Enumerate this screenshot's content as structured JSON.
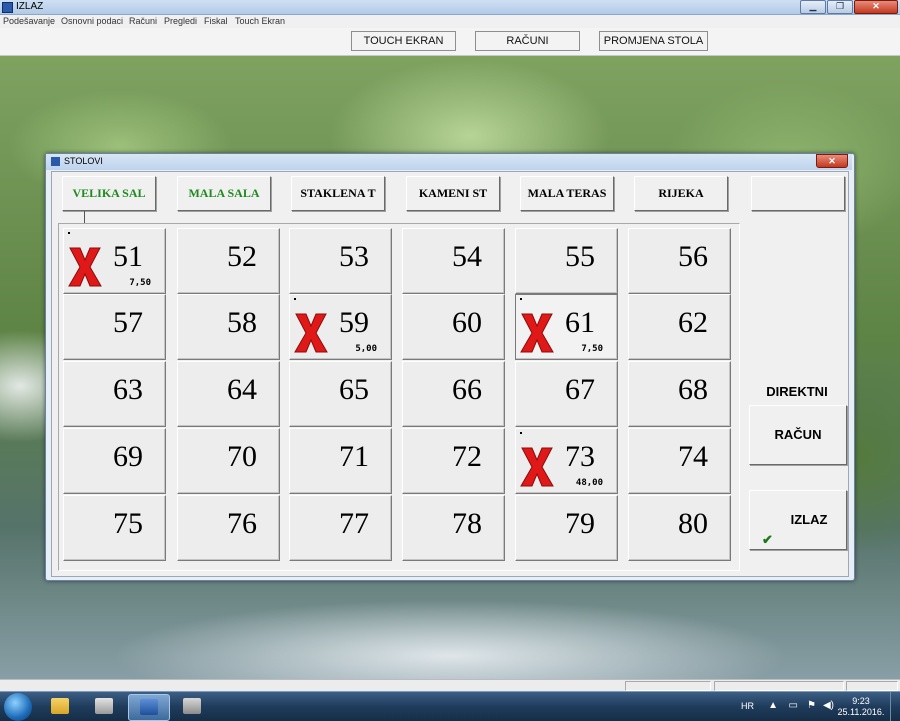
{
  "app": {
    "title": "IZLAZ",
    "window_controls": {
      "minimize": "▁",
      "maximize": "❐",
      "close": "✕"
    }
  },
  "menu": [
    "Podešavanje",
    "Osnovni podaci",
    "Računi",
    "Pregledi",
    "Fiskal",
    "Touch Ekran"
  ],
  "toolbar": {
    "touch_label": "TOUCH  EKRAN",
    "racuni_label": "RAČUNI",
    "promjena_label": "PROMJENA STOLA"
  },
  "dialog": {
    "title": "STOLOVI",
    "close": "✕",
    "rooms": [
      {
        "label": "VELIKA SAL",
        "color": "#1f8a1f"
      },
      {
        "label": "MALA SALA",
        "color": "#1f8a1f"
      },
      {
        "label": "STAKLENA T",
        "color": "#000000"
      },
      {
        "label": "KAMENI ST",
        "color": "#000000"
      },
      {
        "label": "MALA TERAS",
        "color": "#000000"
      },
      {
        "label": "RIJEKA",
        "color": "#000000"
      },
      {
        "label": "",
        "color": "#000000"
      }
    ],
    "tables": [
      {
        "number": "51",
        "occupied": true,
        "amount": "7,50"
      },
      {
        "number": "52",
        "occupied": false,
        "amount": ""
      },
      {
        "number": "53",
        "occupied": false,
        "amount": ""
      },
      {
        "number": "54",
        "occupied": false,
        "amount": ""
      },
      {
        "number": "55",
        "occupied": false,
        "amount": ""
      },
      {
        "number": "56",
        "occupied": false,
        "amount": ""
      },
      {
        "number": "57",
        "occupied": false,
        "amount": ""
      },
      {
        "number": "58",
        "occupied": false,
        "amount": ""
      },
      {
        "number": "59",
        "occupied": true,
        "amount": "5,00"
      },
      {
        "number": "60",
        "occupied": false,
        "amount": ""
      },
      {
        "number": "61",
        "occupied": true,
        "amount": "7,50",
        "selected": true
      },
      {
        "number": "62",
        "occupied": false,
        "amount": ""
      },
      {
        "number": "63",
        "occupied": false,
        "amount": ""
      },
      {
        "number": "64",
        "occupied": false,
        "amount": ""
      },
      {
        "number": "65",
        "occupied": false,
        "amount": ""
      },
      {
        "number": "66",
        "occupied": false,
        "amount": ""
      },
      {
        "number": "67",
        "occupied": false,
        "amount": ""
      },
      {
        "number": "68",
        "occupied": false,
        "amount": ""
      },
      {
        "number": "69",
        "occupied": false,
        "amount": ""
      },
      {
        "number": "70",
        "occupied": false,
        "amount": ""
      },
      {
        "number": "71",
        "occupied": false,
        "amount": ""
      },
      {
        "number": "72",
        "occupied": false,
        "amount": ""
      },
      {
        "number": "73",
        "occupied": true,
        "amount": "48,00"
      },
      {
        "number": "74",
        "occupied": false,
        "amount": ""
      },
      {
        "number": "75",
        "occupied": false,
        "amount": ""
      },
      {
        "number": "76",
        "occupied": false,
        "amount": ""
      },
      {
        "number": "77",
        "occupied": false,
        "amount": ""
      },
      {
        "number": "78",
        "occupied": false,
        "amount": ""
      },
      {
        "number": "79",
        "occupied": false,
        "amount": ""
      },
      {
        "number": "80",
        "occupied": false,
        "amount": ""
      }
    ],
    "direktni_label": "DIREKTNI",
    "racun_label": "RAČUN",
    "izlaz_label": "IZLAZ",
    "occupied_color": "#e01818"
  },
  "taskbar": {
    "language": "HR",
    "time": "9:23",
    "date": "25.11.2016."
  },
  "colors": {
    "accent_green": "#1f8a1f",
    "occupied_red": "#e01818",
    "taskbar": "#1f3c5c"
  }
}
